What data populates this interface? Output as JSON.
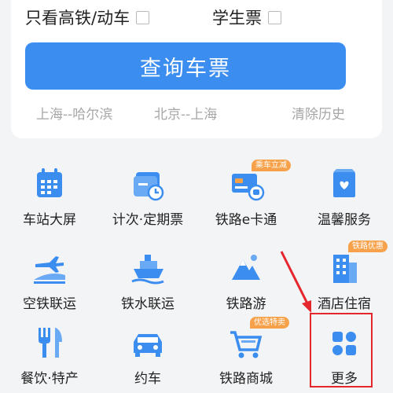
{
  "options": {
    "high_speed_only": "只看高铁/动车",
    "student_ticket": "学生票"
  },
  "query_button": "查询车票",
  "history": {
    "items": [
      "上海--哈尔滨",
      "北京--上海"
    ],
    "clear": "清除历史"
  },
  "services": [
    {
      "label": "车站大屏",
      "icon": "calendar-board-icon"
    },
    {
      "label": "计次·定期票",
      "icon": "ticket-clock-icon"
    },
    {
      "label": "铁路e卡通",
      "icon": "card-train-icon",
      "badge": "乘车立减"
    },
    {
      "label": "温馨服务",
      "icon": "heart-bag-icon"
    },
    {
      "label": "空铁联运",
      "icon": "plane-train-icon"
    },
    {
      "label": "铁水联运",
      "icon": "ship-icon"
    },
    {
      "label": "铁路游",
      "icon": "mountain-icon"
    },
    {
      "label": "酒店住宿",
      "icon": "hotel-icon",
      "badge": "铁路优惠"
    },
    {
      "label": "餐饮·特产",
      "icon": "fork-knife-icon"
    },
    {
      "label": "约车",
      "icon": "car-icon"
    },
    {
      "label": "铁路商城",
      "icon": "cart-icon",
      "badge": "优选特卖"
    },
    {
      "label": "更多",
      "icon": "grid-more-icon"
    }
  ],
  "colors": {
    "primary": "#3b8df0",
    "badge": "#f7a24a",
    "annotation": "#e4262d"
  }
}
